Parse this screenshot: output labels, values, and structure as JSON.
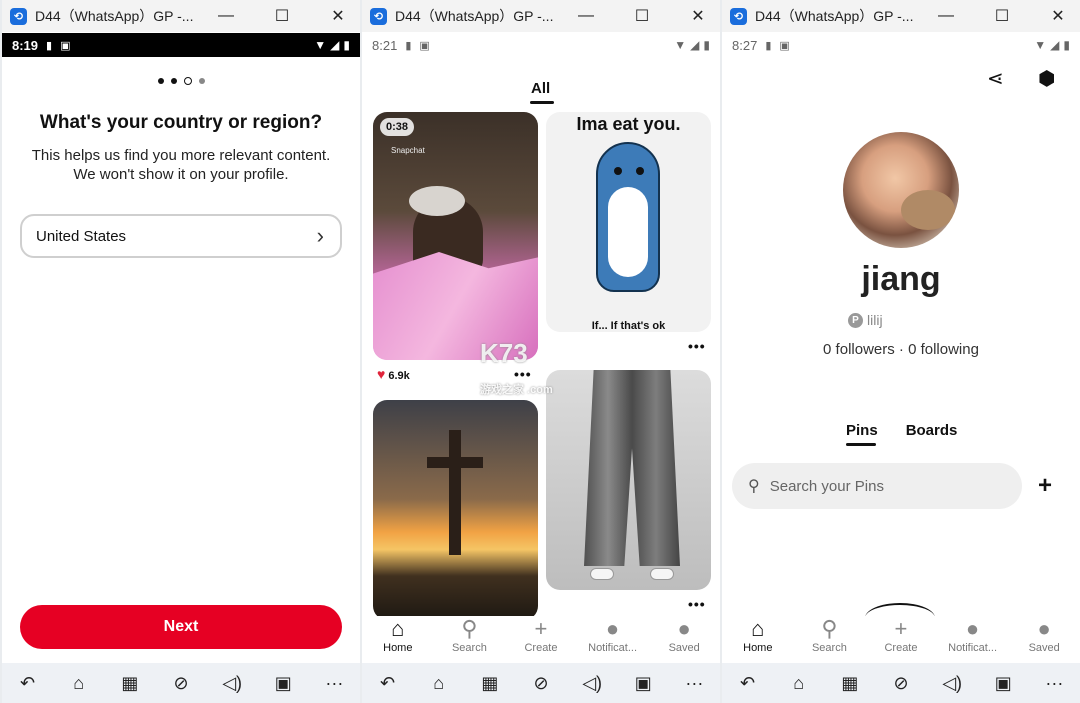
{
  "window_title": "D44（WhatsApp）GP -...",
  "window_buttons": {
    "minimize": "—",
    "maximize": "☐",
    "close": "✕"
  },
  "panels": [
    {
      "status": {
        "time": "8:19"
      },
      "onboarding": {
        "title": "What's your country or region?",
        "subtitle": "This helps us find you more relevant content. We won't show it on your profile.",
        "country_value": "United States",
        "next_label": "Next"
      }
    },
    {
      "status": {
        "time": "8:21"
      },
      "feed": {
        "tab_label": "All",
        "video_duration": "0:38",
        "video_watermark": "Snapchat",
        "likes": "6.9k",
        "meme_top": "Ima eat you.",
        "meme_bottom": "If... If that's ok",
        "watermark": "K73",
        "watermark_sub": "游戏之家 .com"
      }
    },
    {
      "status": {
        "time": "8:27"
      },
      "profile": {
        "name": "jiang",
        "username": "lilij",
        "follow_stats": "0 followers · 0 following",
        "tab_pins": "Pins",
        "tab_boards": "Boards",
        "search_placeholder": "Search your Pins"
      }
    }
  ],
  "nav": {
    "home": "Home",
    "search": "Search",
    "create": "Create",
    "notifications": "Notificat...",
    "saved": "Saved"
  },
  "icons": {
    "app": "app-switch-icon",
    "home": "⌂",
    "search": "⚲",
    "create": "+",
    "chat": "●",
    "saved": "●",
    "back": "↶",
    "apps": "▦",
    "volume": "🔈",
    "more": "···"
  },
  "colors": {
    "accent": "#e60023",
    "app_icon": "#1a6ddc"
  }
}
